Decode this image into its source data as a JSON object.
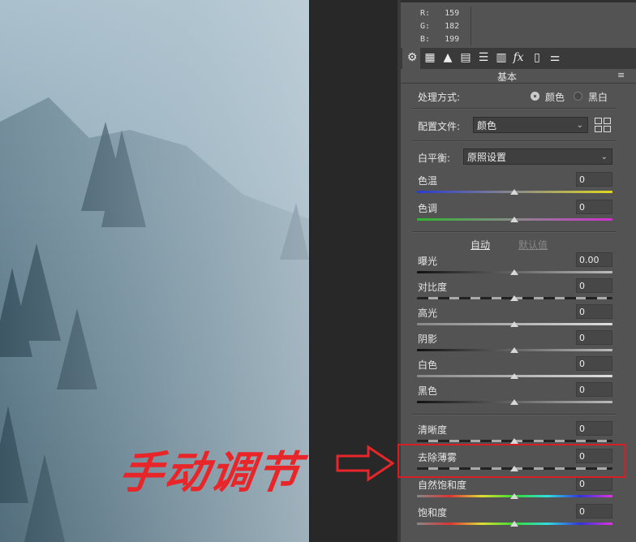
{
  "readout": {
    "r_label": "R:",
    "r": "159",
    "g_label": "G:",
    "g": "182",
    "b_label": "B:",
    "b": "199"
  },
  "toolbar": [
    "aperture-icon",
    "grid-curve-icon",
    "mountain-icon",
    "split-gradient-icon",
    "bars-icon",
    "lens-icon",
    "fx-icon",
    "film-icon",
    "sliders-icon"
  ],
  "panel_title": "基本",
  "process": {
    "label": "处理方式:",
    "option_color": "颜色",
    "option_bw": "黑白",
    "selected": "颜色"
  },
  "profile": {
    "label": "配置文件:",
    "value": "颜色"
  },
  "white_balance": {
    "label": "白平衡:",
    "value": "原照设置"
  },
  "auto_label": "自动",
  "default_label": "默认值",
  "sliders": [
    {
      "label": "色温",
      "value": "0",
      "track": "temp"
    },
    {
      "label": "色调",
      "value": "0",
      "track": "tint"
    },
    {
      "label": "曝光",
      "value": "0.00",
      "track": "dark"
    },
    {
      "label": "对比度",
      "value": "0",
      "track": "contrast"
    },
    {
      "label": "高光",
      "value": "0",
      "track": "light"
    },
    {
      "label": "阴影",
      "value": "0",
      "track": "dark"
    },
    {
      "label": "白色",
      "value": "0",
      "track": "light"
    },
    {
      "label": "黑色",
      "value": "0",
      "track": "dark"
    },
    {
      "label": "清晰度",
      "value": "0",
      "track": "contrast"
    },
    {
      "label": "去除薄雾",
      "value": "0",
      "track": "contrast"
    },
    {
      "label": "自然饱和度",
      "value": "0",
      "track": "rainbow"
    },
    {
      "label": "饱和度",
      "value": "0",
      "track": "rainbow"
    }
  ],
  "annotation": {
    "text": "手动调节",
    "color": "#e8262a"
  }
}
